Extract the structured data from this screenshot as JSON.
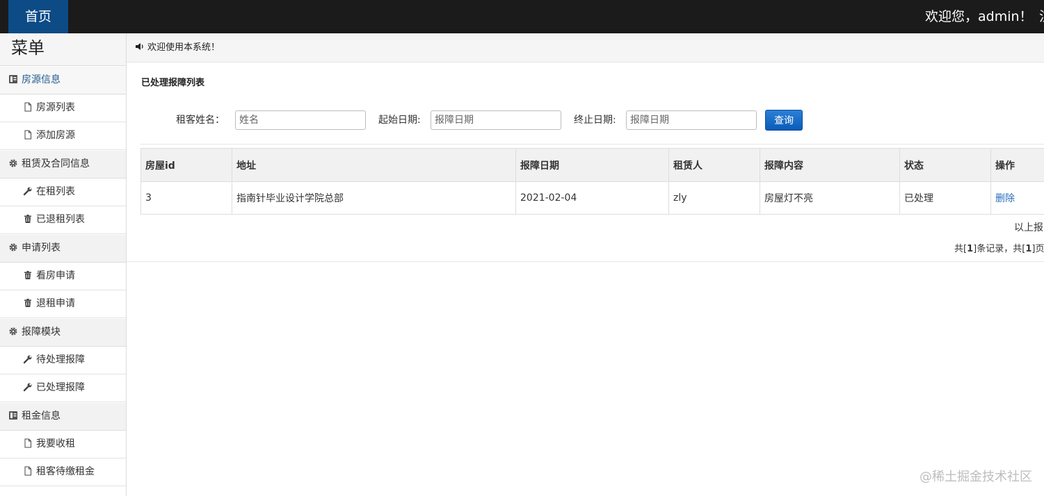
{
  "topbar": {
    "home": "首页",
    "welcome_user": "欢迎您，admin！",
    "cut_text": "注"
  },
  "sidebar": {
    "title": "菜单",
    "groups": [
      {
        "label": "房源信息",
        "items": [
          "房源列表",
          "添加房源"
        ]
      },
      {
        "label": "租赁及合同信息",
        "items": [
          "在租列表",
          "已退租列表"
        ]
      },
      {
        "label": "申请列表",
        "items": [
          "看房申请",
          "退租申请"
        ]
      },
      {
        "label": "报障模块",
        "items": [
          "待处理报障",
          "已处理报障"
        ]
      },
      {
        "label": "租金信息",
        "items": [
          "我要收租",
          "租客待缴租金"
        ]
      }
    ]
  },
  "notice": "欢迎使用本系统！",
  "panel_title": "已处理报障列表",
  "filters": {
    "name_label": "租客姓名：",
    "name_placeholder": "姓名",
    "start_label": "起始日期:",
    "start_placeholder": "报障日期",
    "end_label": "终止日期:",
    "end_placeholder": "报障日期",
    "search_button": "查询"
  },
  "table": {
    "headers": [
      "房屋id",
      "地址",
      "报障日期",
      "租赁人",
      "报障内容",
      "状态",
      "操作"
    ],
    "rows": [
      [
        "3",
        "指南针毕业设计学院总部",
        "2021-02-04",
        "zly",
        "房屋灯不亮",
        "已处理",
        "删除"
      ]
    ]
  },
  "summary": "以上报",
  "pager": {
    "pre": "共",
    "total": "1",
    "mid": "条记录，共",
    "pages": "1",
    "post": "页"
  },
  "watermark": "@稀土掘金技术社区"
}
